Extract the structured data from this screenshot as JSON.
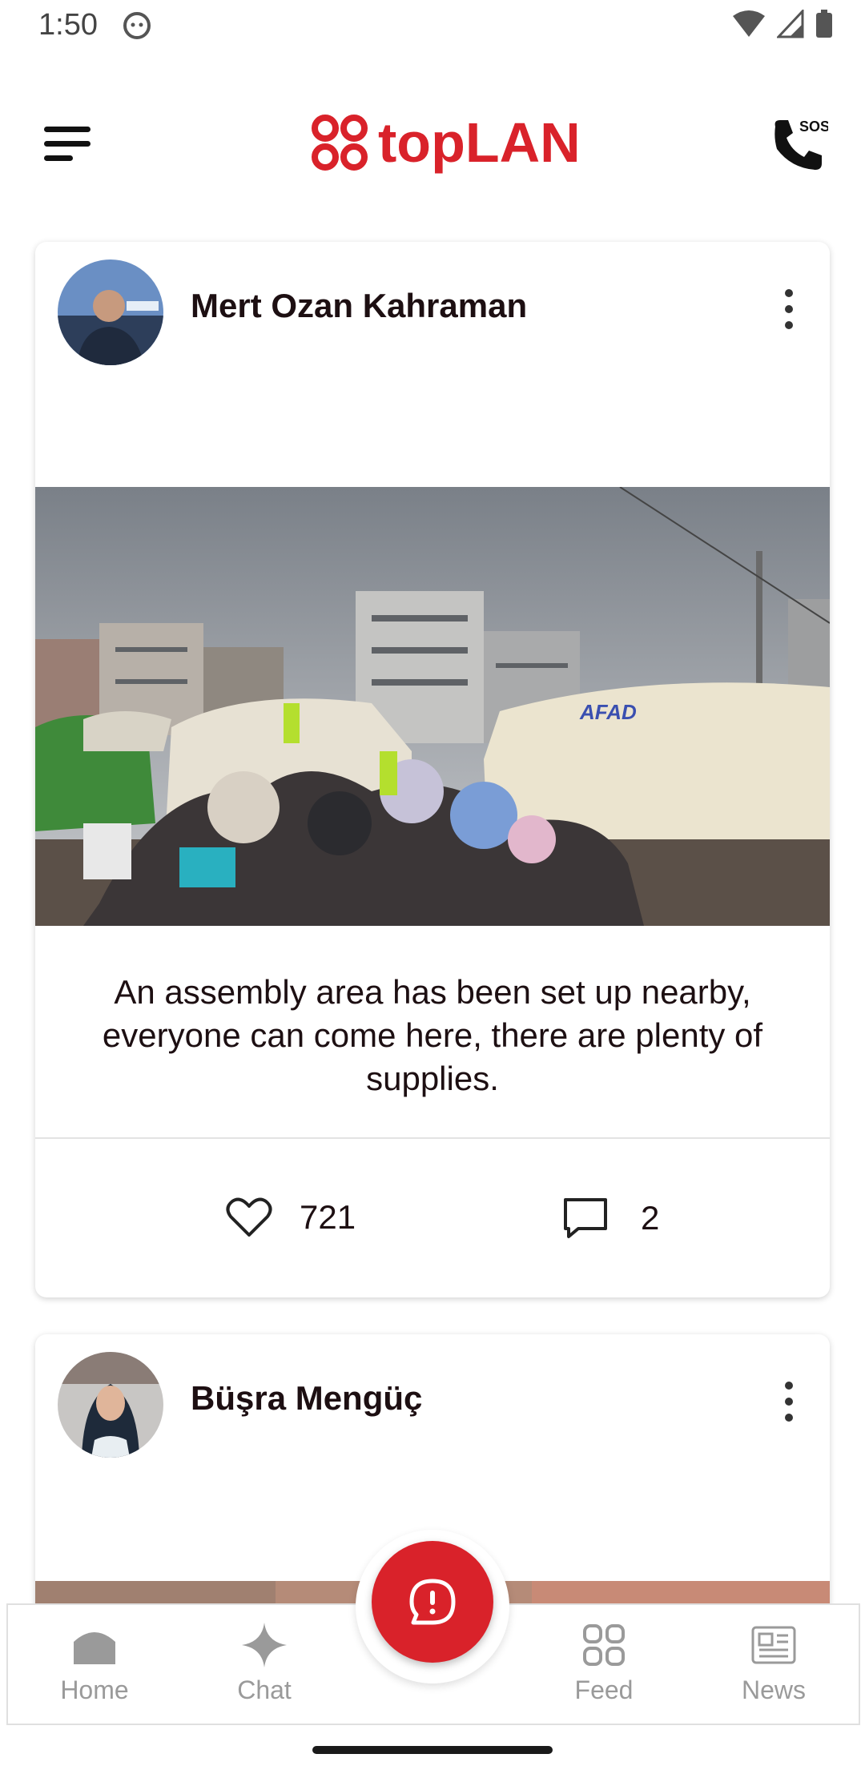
{
  "status_bar": {
    "time": "1:50"
  },
  "app_bar": {
    "logo_text": "topLAN"
  },
  "posts": [
    {
      "author": "Mert Ozan Kahraman",
      "image_text": "AFAD",
      "caption": "An assembly area has been set up nearby, everyone can come here, there are plenty of supplies.",
      "likes": "721",
      "comments": "2"
    },
    {
      "author": "Büşra Mengüç"
    }
  ],
  "bottom_nav": {
    "items": [
      {
        "label": "Home"
      },
      {
        "label": "Chat"
      },
      {
        "label": "Feed"
      },
      {
        "label": "News"
      }
    ]
  },
  "colors": {
    "accent": "#d9222a",
    "nav_inactive": "#9a9a9a"
  }
}
